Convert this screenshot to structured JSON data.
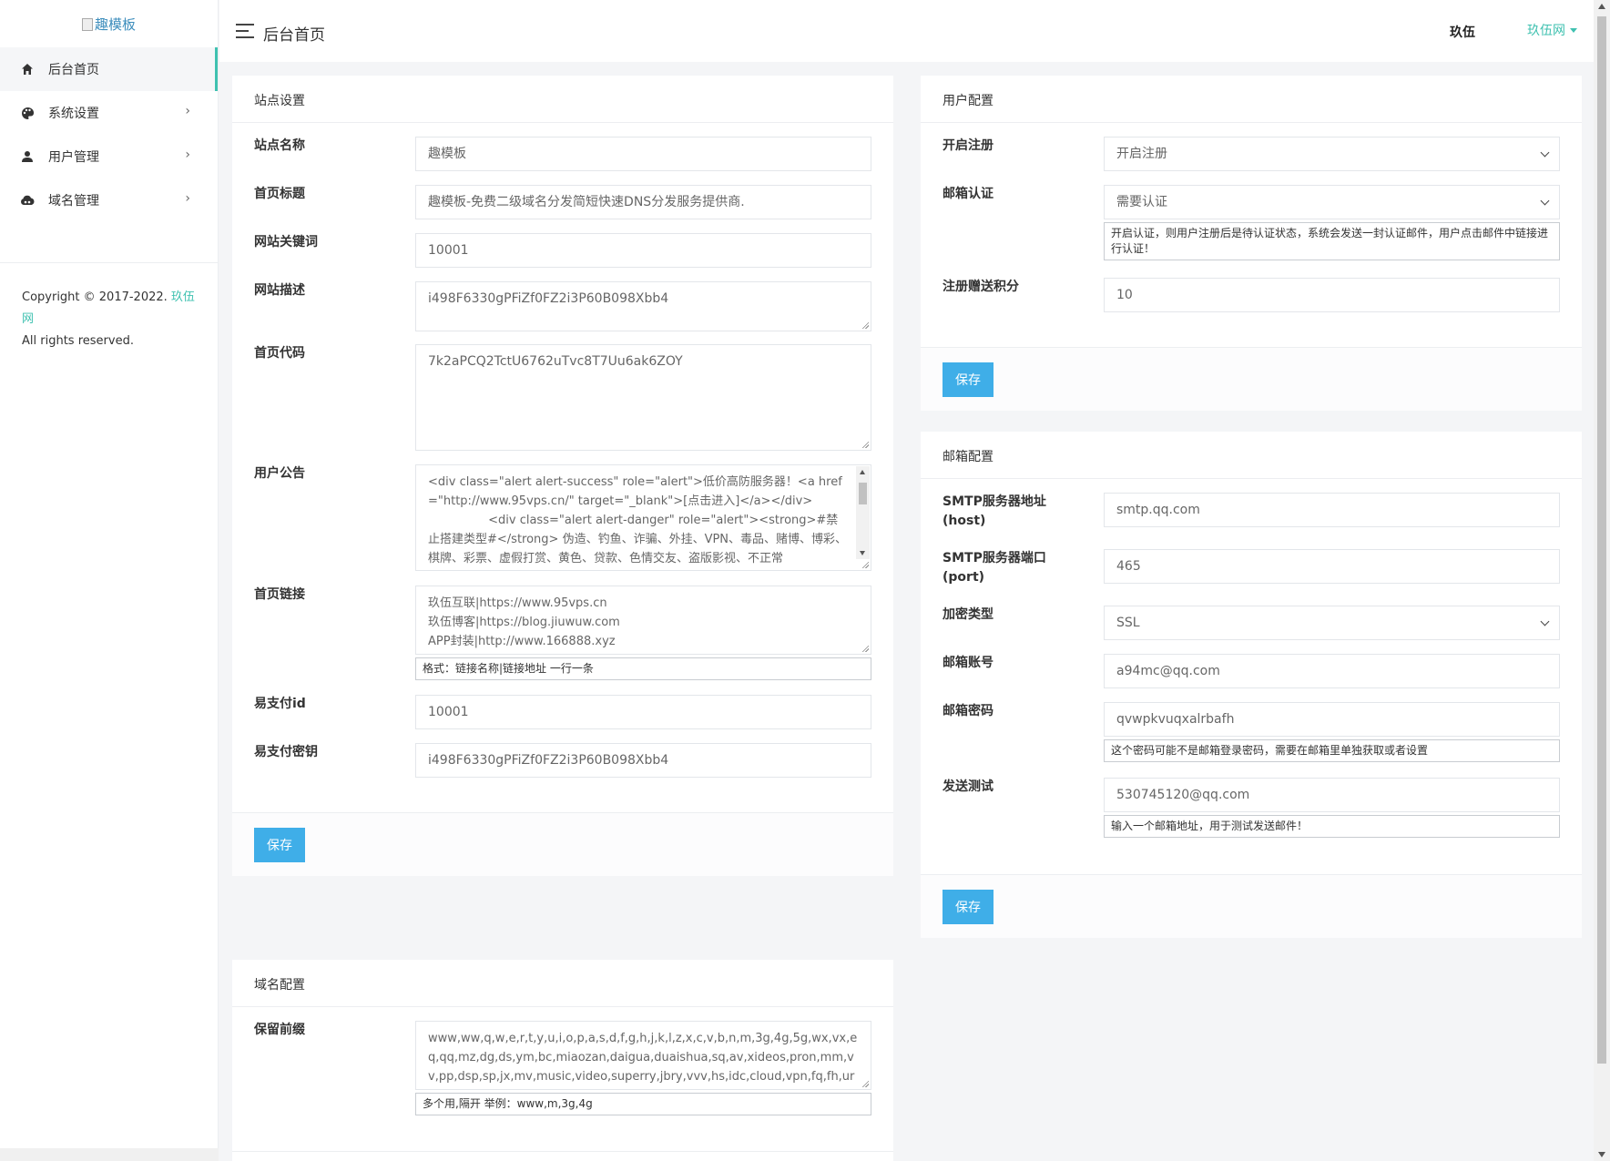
{
  "sidebar": {
    "logo_alt": "趣模板",
    "items": [
      {
        "label": "后台首页",
        "icon": "home-icon"
      },
      {
        "label": "系统设置",
        "icon": "palette-icon"
      },
      {
        "label": "用户管理",
        "icon": "user-icon"
      },
      {
        "label": "域名管理",
        "icon": "cloud-icon"
      }
    ],
    "copyright_prefix": "Copyright © 2017-2022.",
    "copyright_link": "玖伍网",
    "copyright_suffix": "All rights reserved."
  },
  "header": {
    "title": "后台首页",
    "user": "玖伍",
    "site_menu": "玖伍网"
  },
  "site_settings": {
    "title": "站点设置",
    "fields": {
      "site_name": {
        "label": "站点名称",
        "value": "趣模板"
      },
      "home_title": {
        "label": "首页标题",
        "value": "趣模板-免费二级域名分发简短快速DNS分发服务提供商."
      },
      "keywords": {
        "label": "网站关键词",
        "value": "10001"
      },
      "description": {
        "label": "网站描述",
        "value": "i498F6330gPFiZf0FZ2i3P60B098Xbb4"
      },
      "home_code": {
        "label": "首页代码",
        "value": "7k2aPCQ2TctU6762uTvc8T7Uu6ak6ZOY"
      },
      "notice": {
        "label": "用户公告",
        "value": "<div class=\"alert alert-success\" role=\"alert\">低价高防服务器！<a href=\"http://www.95vps.cn/\" target=\"_blank\">[点击进入]</a></div>\n                <div class=\"alert alert-danger\" role=\"alert\"><strong>#禁止搭建类型#</strong> 伪造、钓鱼、诈骗、外挂、VPN、毒品、赌博、博彩、棋牌、彩票、虚假打赏、黄色、贷款、色情交友、盗版影视、不正常"
      },
      "home_links": {
        "label": "首页链接",
        "value": "玖伍互联|https://www.95vps.cn\n玖伍博客|https://blog.jiuwuw.com\nAPP封装|http://www.166888.xyz",
        "help": "格式：链接名称|链接地址 一行一条"
      },
      "pay_id": {
        "label": "易支付id",
        "value": "10001"
      },
      "pay_key": {
        "label": "易支付密钥",
        "value": "i498F6330gPFiZf0FZ2i3P60B098Xbb4"
      }
    },
    "save_label": "保存"
  },
  "user_config": {
    "title": "用户配置",
    "register": {
      "label": "开启注册",
      "value": "开启注册"
    },
    "email_verify": {
      "label": "邮箱认证",
      "value": "需要认证",
      "help": "开启认证，则用户注册后是待认证状态，系统会发送一封认证邮件，用户点击邮件中链接进行认证！"
    },
    "bonus": {
      "label": "注册赠送积分",
      "value": "10"
    },
    "save_label": "保存"
  },
  "mail_config": {
    "title": "邮箱配置",
    "host": {
      "label": "SMTP服务器地址(host)",
      "value": "smtp.qq.com"
    },
    "port": {
      "label": "SMTP服务器端口(port)",
      "value": "465"
    },
    "encryption": {
      "label": "加密类型",
      "value": "SSL"
    },
    "account": {
      "label": "邮箱账号",
      "value": "a94mc@qq.com"
    },
    "password": {
      "label": "邮箱密码",
      "value": "qvwpkvuqxalrbafh",
      "help": "这个密码可能不是邮箱登录密码，需要在邮箱里单独获取或者设置"
    },
    "test": {
      "label": "发送测试",
      "value": "530745120@qq.com",
      "help": "输入一个邮箱地址，用于测试发送邮件！"
    },
    "save_label": "保存"
  },
  "domain_config": {
    "title": "域名配置",
    "reserved": {
      "label": "保留前缀",
      "value": "www,ww,q,w,e,r,t,y,u,i,o,p,a,s,d,f,g,h,j,k,l,z,x,c,v,b,n,m,3g,4g,5g,wx,vx,eq,qq,mz,dg,ds,ym,bc,miaozan,daigua,duaishua,sq,av,xideos,pron,mm,vv,pp,dsp,sp,jx,mv,music,video,superry,jbry,vvv,hs,idc,cloud,vpn,fq,fh,url,dwz",
      "help": "多个用,隔开 举例：www,m,3g,4g"
    }
  }
}
